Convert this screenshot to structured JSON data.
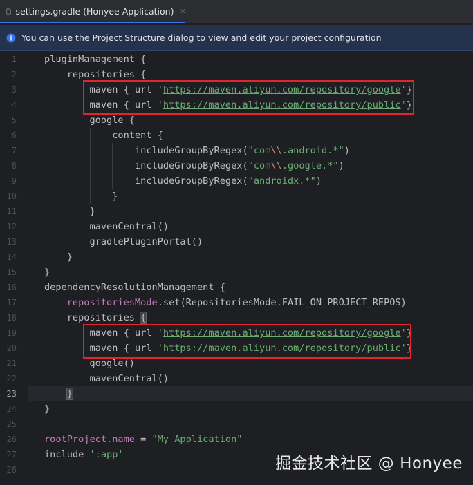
{
  "tab": {
    "title": "settings.gradle (Honyee Application)",
    "close_icon": "close-icon",
    "file_icon": "gradle-file-icon"
  },
  "banner": {
    "icon": "info-icon",
    "text": "You can use the Project Structure dialog to view and edit your project configuration"
  },
  "editor": {
    "line_numbers": [
      "1",
      "2",
      "3",
      "4",
      "5",
      "6",
      "7",
      "8",
      "9",
      "10",
      "11",
      "12",
      "13",
      "14",
      "15",
      "16",
      "17",
      "18",
      "19",
      "20",
      "21",
      "22",
      "23",
      "24",
      "25",
      "26",
      "27",
      "28"
    ],
    "current_line": "23",
    "code": {
      "l1": {
        "a": "pluginManagement {"
      },
      "l2": {
        "a": "    repositories {"
      },
      "l3": {
        "a": "        maven { url '",
        "url": "https://maven.aliyun.com/repository/google",
        "b": "'}"
      },
      "l4": {
        "a": "        maven { url '",
        "url": "https://maven.aliyun.com/repository/public",
        "b": "'}"
      },
      "l5": {
        "a": "        google {"
      },
      "l6": {
        "a": "            content {"
      },
      "l7": {
        "a": "                includeGroupByRegex(",
        "s1": "\"com",
        "esc": "\\\\",
        "s2": ".android.*\"",
        "b": ")"
      },
      "l8": {
        "a": "                includeGroupByRegex(",
        "s1": "\"com",
        "esc": "\\\\",
        "s2": ".google.*\"",
        "b": ")"
      },
      "l9": {
        "a": "                includeGroupByRegex(",
        "s1": "\"androidx.*\"",
        "b": ")"
      },
      "l10": {
        "a": "            }"
      },
      "l11": {
        "a": "        }"
      },
      "l12": {
        "a": "        mavenCentral()"
      },
      "l13": {
        "a": "        gradlePluginPortal()"
      },
      "l14": {
        "a": "    }"
      },
      "l15": {
        "a": "}"
      },
      "l16": {
        "a": "dependencyResolutionManagement {"
      },
      "l17": {
        "indent": "    ",
        "prop": "repositoriesMode",
        "b": ".set(RepositoriesMode.FAIL_ON_PROJECT_REPOS)"
      },
      "l18": {
        "a": "    repositories ",
        "brace": "{"
      },
      "l19": {
        "a": "        maven { url '",
        "url": "https://maven.aliyun.com/repository/google",
        "b": "'}"
      },
      "l20": {
        "a": "        maven { url '",
        "url": "https://maven.aliyun.com/repository/public",
        "b": "'}"
      },
      "l21": {
        "a": "        google()"
      },
      "l22": {
        "a": "        mavenCentral()"
      },
      "l23": {
        "indent": "    ",
        "brace": "}"
      },
      "l24": {
        "a": "}"
      },
      "l25": {
        "a": ""
      },
      "l26": {
        "prop": "rootProject.name",
        "a": " = ",
        "s1": "\"My Application\""
      },
      "l27": {
        "a": "include ",
        "s1": "':app'"
      },
      "l28": {
        "a": ""
      }
    }
  },
  "watermark": "掘金技术社区 @ Honyee",
  "colors": {
    "background": "#1e1f22",
    "tabbar": "#2b2d30",
    "banner": "#25324d",
    "highlight_box": "#e0262c",
    "string": "#6aab73",
    "property": "#c77dbb",
    "escape": "#cf8e6d"
  }
}
